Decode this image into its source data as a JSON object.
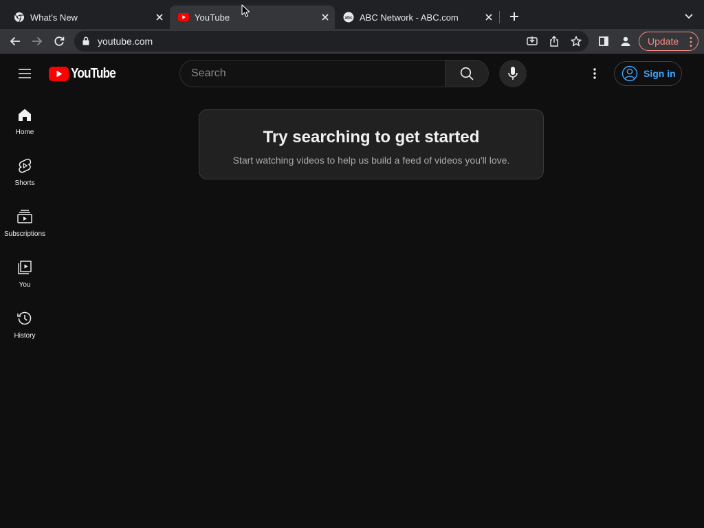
{
  "browser": {
    "tabs": [
      {
        "title": "What's New",
        "favicon": "chrome-icon",
        "active": false
      },
      {
        "title": "YouTube",
        "favicon": "youtube-icon",
        "active": true
      },
      {
        "title": "ABC Network - ABC.com",
        "favicon": "abc-icon",
        "active": false
      }
    ],
    "url": "youtube.com",
    "update_label": "Update"
  },
  "youtube": {
    "logo_text": "YouTube",
    "search": {
      "placeholder": "Search",
      "value": ""
    },
    "signin_label": "Sign in",
    "guide": [
      {
        "label": "Home",
        "icon": "home-icon"
      },
      {
        "label": "Shorts",
        "icon": "shorts-icon"
      },
      {
        "label": "Subscriptions",
        "icon": "subscriptions-icon"
      },
      {
        "label": "You",
        "icon": "you-icon"
      },
      {
        "label": "History",
        "icon": "history-icon"
      }
    ],
    "empty_state": {
      "title": "Try searching to get started",
      "subtitle": "Start watching videos to help us build a feed of videos you'll love."
    }
  },
  "colors": {
    "background": "#0f0f0f",
    "accent_red": "#ff0000",
    "link_blue": "#3ea6ff",
    "update_red": "#f28b82"
  }
}
